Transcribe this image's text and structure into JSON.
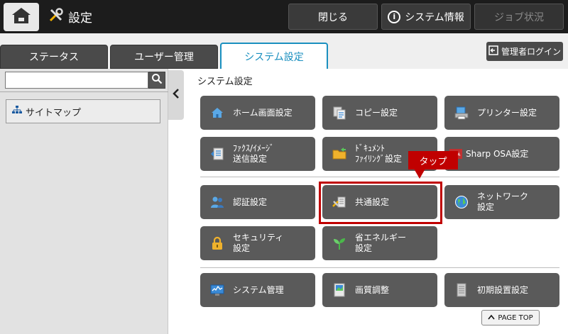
{
  "header": {
    "title": "設定",
    "close_label": "閉じる",
    "system_info_label": "システム情報",
    "job_status_label": "ジョブ状況"
  },
  "tabs": [
    {
      "label": "ステータス"
    },
    {
      "label": "ユーザー管理"
    },
    {
      "label": "システム設定"
    }
  ],
  "admin_login_label": "管理者ログイン",
  "sidebar": {
    "search_value": "",
    "sitemap_label": "サイトマップ"
  },
  "main": {
    "title": "システム設定",
    "tiles": [
      {
        "label": "ホーム画面設定"
      },
      {
        "label": "コピー設定"
      },
      {
        "label": "プリンター設定"
      },
      {
        "label": "ﾌｧｸｽ/ｲﾒｰｼﾞ\n送信設定"
      },
      {
        "label": "ﾄﾞｷｭﾒﾝﾄ\nﾌｧｲﾘﾝｸﾞ設定"
      },
      {
        "label": "Sharp OSA設定"
      },
      {
        "label": "認証設定"
      },
      {
        "label": "共通設定"
      },
      {
        "label": "ネットワーク\n設定"
      },
      {
        "label": "セキュリティ\n設定"
      },
      {
        "label": "省エネルギー\n設定"
      },
      {
        "label": "システム管理"
      },
      {
        "label": "画質調整"
      },
      {
        "label": "初期設置設定"
      }
    ],
    "callout_label": "タップ",
    "page_top_label": "PAGE TOP"
  },
  "colors": {
    "accent": "#1a8fbf",
    "highlight": "#c00000",
    "tile_bg": "#5a5a5a"
  }
}
